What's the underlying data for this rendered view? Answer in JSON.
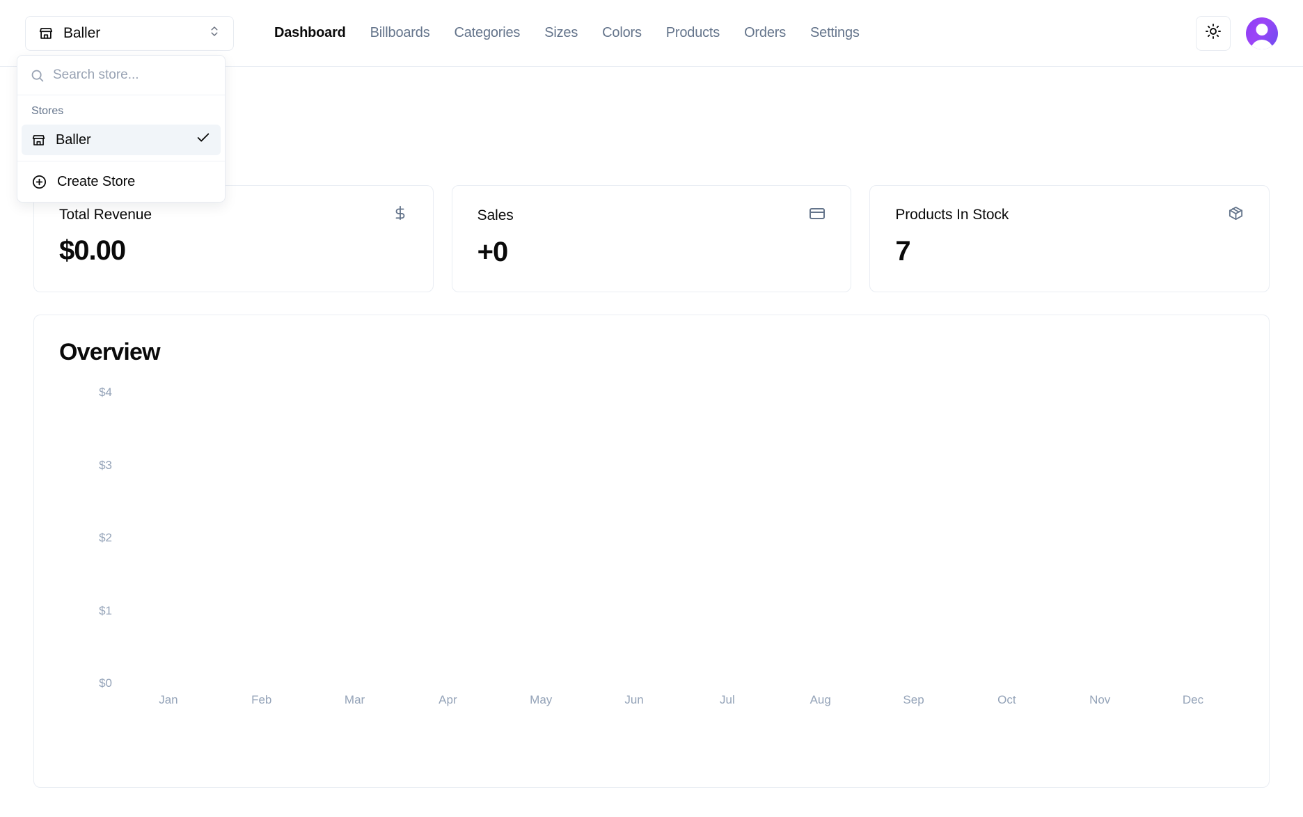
{
  "topbar": {
    "store_switcher": {
      "label": "Baller",
      "icon": "store-icon",
      "chevron_icon": "chevrons-up-down-icon"
    },
    "nav": [
      {
        "label": "Dashboard",
        "active": true
      },
      {
        "label": "Billboards",
        "active": false
      },
      {
        "label": "Categories",
        "active": false
      },
      {
        "label": "Sizes",
        "active": false
      },
      {
        "label": "Colors",
        "active": false
      },
      {
        "label": "Products",
        "active": false
      },
      {
        "label": "Orders",
        "active": false
      },
      {
        "label": "Settings",
        "active": false
      }
    ],
    "theme_toggle_icon": "sun-icon",
    "avatar": {
      "icon": "user-avatar-icon",
      "gradient_from": "#8b3df5",
      "gradient_to": "#6d4df0"
    }
  },
  "store_dropdown": {
    "open": true,
    "search": {
      "placeholder": "Search store...",
      "value": "",
      "icon": "search-icon"
    },
    "group_label": "Stores",
    "items": [
      {
        "label": "Baller",
        "icon": "store-icon",
        "selected": true,
        "check_icon": "check-icon"
      }
    ],
    "create": {
      "label": "Create Store",
      "icon": "plus-circle-icon"
    }
  },
  "main": {
    "page_title": "",
    "page_description": "",
    "cards": [
      {
        "title": "Total Revenue",
        "value": "$0.00",
        "icon": "dollar-sign-icon"
      },
      {
        "title": "Sales",
        "value": "+0",
        "icon": "credit-card-icon"
      },
      {
        "title": "Products In Stock",
        "value": "7",
        "icon": "package-icon"
      }
    ]
  },
  "chart_data": {
    "type": "bar",
    "title": "Overview",
    "categories": [
      "Jan",
      "Feb",
      "Mar",
      "Apr",
      "May",
      "Jun",
      "Jul",
      "Aug",
      "Sep",
      "Oct",
      "Nov",
      "Dec"
    ],
    "values": [
      0,
      0,
      0,
      0,
      0,
      0,
      0,
      0,
      0,
      0,
      0,
      0
    ],
    "ytick_labels": [
      "$4",
      "$3",
      "$2",
      "$1",
      "$0"
    ],
    "ytick_values": [
      4,
      3,
      2,
      1,
      0
    ],
    "xlabel": "",
    "ylabel": "",
    "ylim": [
      0,
      4
    ],
    "grid": false,
    "legend": false,
    "bar_color": "#7c3aed"
  }
}
